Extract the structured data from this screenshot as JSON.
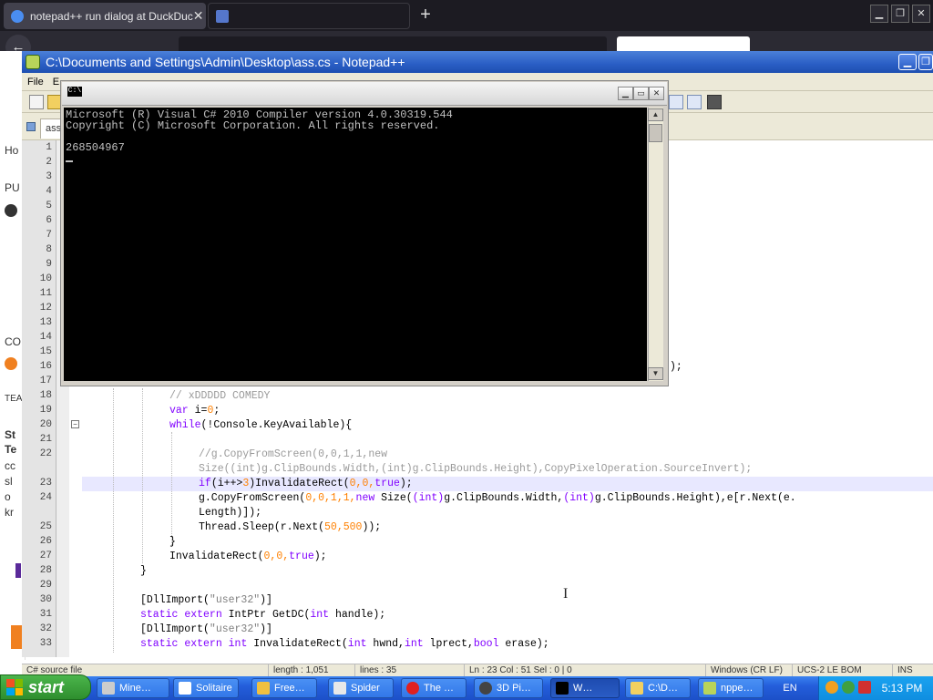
{
  "browser": {
    "tab1_title": "notepad++ run dialog at DuckDuc",
    "tab2_title": "",
    "new_tab_icon": "plus-icon",
    "sidebar_snippets": [
      "Ho",
      "PU",
      "CO",
      "TEA",
      "St",
      "Te",
      "cc",
      "sl",
      "o",
      "kr"
    ]
  },
  "npp": {
    "title": "C:\\Documents and Settings\\Admin\\Desktop\\ass.cs - Notepad++",
    "menu": [
      "File",
      "E"
    ],
    "tab_label": "ass.",
    "status": {
      "lang": "C# source file",
      "length": "length : 1,051",
      "lines": "lines : 35",
      "pos": "Ln : 23    Col : 51    Sel : 0 | 0",
      "eol": "Windows (CR LF)",
      "enc": "UCS-2 LE BOM",
      "ins": "INS"
    },
    "line_numbers": [
      "1",
      "2",
      "3",
      "4",
      "5",
      "6",
      "7",
      "8",
      "9",
      "10",
      "11",
      "12",
      "13",
      "14",
      "15",
      "16",
      "17",
      "18",
      "19",
      "20",
      "21",
      "22",
      "",
      "23",
      "24",
      "",
      "25",
      "26",
      "27",
      "28",
      "29",
      "30",
      "31",
      "32",
      "33"
    ],
    "line16_tail": ");",
    "code": {
      "l18": "// xDDDDD COMEDY",
      "l19_kw": "var",
      "l19_rest": " i=",
      "l19_num": "0",
      "l19_end": ";",
      "l20_kw": "while",
      "l20_rest": "(!Console.KeyAvailable){",
      "l22a": "//g.CopyFromScreen(0,0,1,1,new",
      "l22b": "Size((int)g.ClipBounds.Width,(int)g.ClipBounds.Height),CopyPixelOperation.SourceInvert);",
      "l23_kw": "if",
      "l23_a": "(i++>",
      "l23_num": "3",
      "l23_b": ")InvalidateRect(",
      "l23_args": "0,0,",
      "l23_true": "true",
      "l23_end": ");",
      "l24a": "g.CopyFromScreen(",
      "l24_nums": "0,0,1,1,",
      "l24_new": "new",
      "l24_size": " Size(",
      "l24_int1": "(int)",
      "l24_mid": "g.ClipBounds.Width,",
      "l24_int2": "(int)",
      "l24_rest": "g.ClipBounds.Height),e[r.Next(e.",
      "l24b": "Length)]);",
      "l25a": "Thread.Sleep(r.Next(",
      "l25_nums": "50,500",
      "l25_end": "));",
      "l26": "}",
      "l27a": "InvalidateRect(",
      "l27_nums": "0,0,",
      "l27_true": "true",
      "l27_end": ");",
      "l28": "}",
      "l30a": "[DllImport(",
      "l30_str": "\"user32\"",
      "l30_end": ")]",
      "l31_kw1": "static",
      "l31_kw2": "extern",
      "l31_rest": " IntPtr GetDC(",
      "l31_int": "int",
      "l31_end": " handle);",
      "l32a": "[DllImport(",
      "l32_str": "\"user32\"",
      "l32_end": ")]",
      "l33_kw1": "static",
      "l33_kw2": "extern",
      "l33_int": "int",
      "l33_rest": " InvalidateRect(",
      "l33_int2": "int",
      "l33_mid": " hwnd,",
      "l33_int3": "int",
      "l33_mid2": " lprect,",
      "l33_bool": "bool",
      "l33_end": " erase);"
    }
  },
  "console": {
    "icon_text": "C:\\",
    "line1": "Microsoft (R) Visual C# 2010 Compiler version 4.0.30319.544",
    "line2": "Copyright (C) Microsoft Corporation. All rights reserved.",
    "line3": "268504967"
  },
  "taskbar": {
    "start": "start",
    "buttons": [
      "Mine…",
      "Solitaire",
      "Free…",
      "Spider",
      "The …",
      "3D Pi…",
      "W…",
      "C:\\D…",
      "nppe…"
    ],
    "lang": "EN",
    "time": "5:13 PM"
  },
  "colors": {
    "keyword": "#8000ff",
    "number": "#ff8000",
    "comment": "#9a9a9a",
    "xp_blue": "#245edb",
    "start_green": "#2e8e2e"
  }
}
